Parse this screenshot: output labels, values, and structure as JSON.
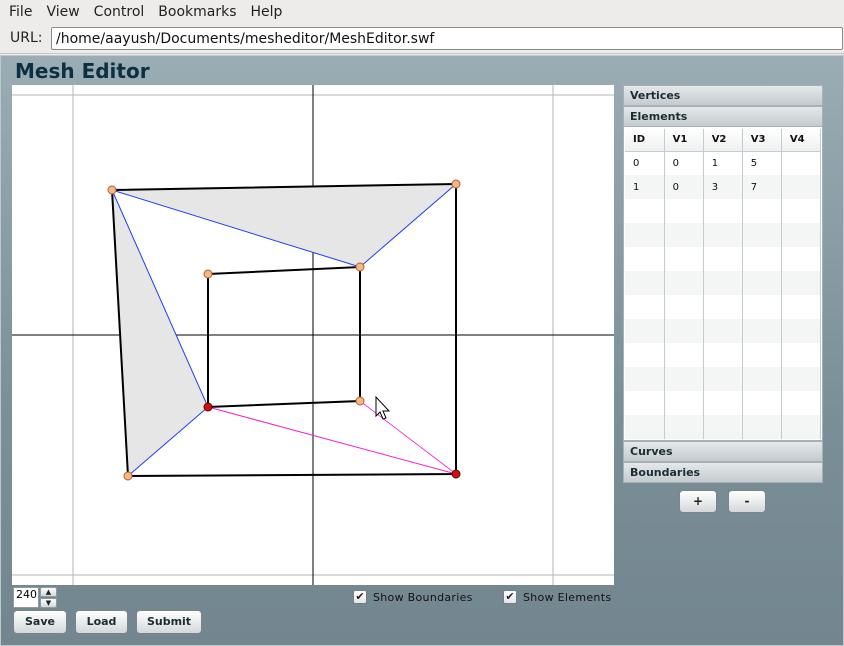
{
  "menu": [
    "File",
    "View",
    "Control",
    "Bookmarks",
    "Help"
  ],
  "url": {
    "label": "URL:",
    "value": "/home/aayush/Documents/mesheditor/MeshEditor.swf"
  },
  "app": {
    "title": "Mesh Editor",
    "zoom_value": "240",
    "show_boundaries_label": "Show Boundaries",
    "show_elements_label": "Show Elements",
    "buttons": {
      "save": "Save",
      "load": "Load",
      "submit": "Submit"
    }
  },
  "side": {
    "sections": {
      "vertices": "Vertices",
      "elements": "Elements",
      "curves": "Curves",
      "boundaries": "Boundaries"
    },
    "columns": [
      "ID",
      "V1",
      "V2",
      "V3",
      "V4"
    ],
    "rows": [
      [
        "0",
        "0",
        "1",
        "5",
        ""
      ],
      [
        "1",
        "0",
        "3",
        "7",
        ""
      ]
    ],
    "add_label": "+",
    "remove_label": "-"
  },
  "colors": {
    "panel": "#7b8f99",
    "title": "#0e2f3f",
    "selected_vertex": "#cc1111",
    "vertex": "#f6b784",
    "blue_edge": "#1f3ef0",
    "magenta_edge": "#ef22d4",
    "fill": "#e6e6e6"
  }
}
